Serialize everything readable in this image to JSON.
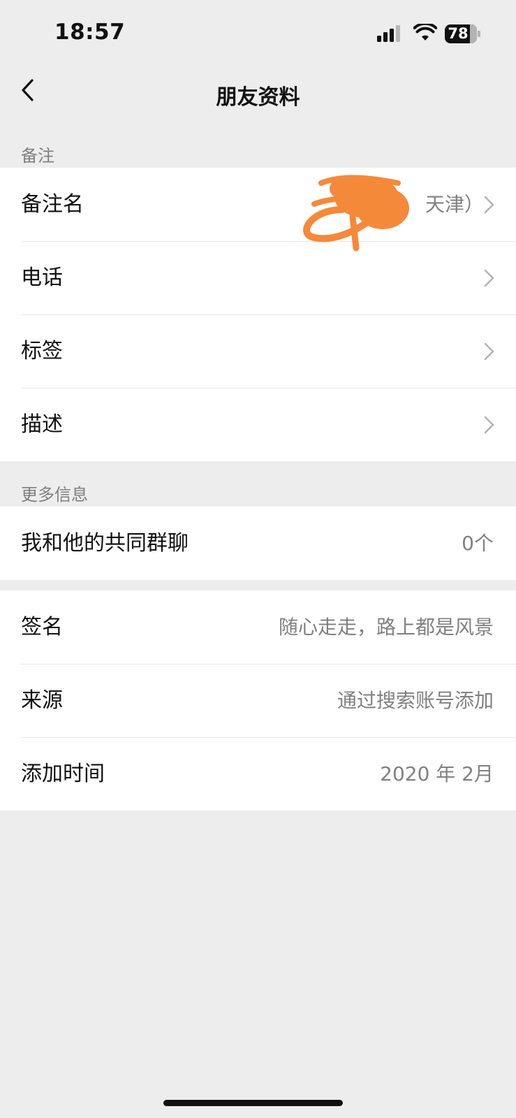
{
  "status_bar": {
    "time": "18:57",
    "battery_level": "78"
  },
  "nav": {
    "title": "朋友资料"
  },
  "section_remark": {
    "header": "备注",
    "rows": [
      {
        "label": "备注名",
        "value": "天津）"
      },
      {
        "label": "电话",
        "value": ""
      },
      {
        "label": "标签",
        "value": ""
      },
      {
        "label": "描述",
        "value": ""
      }
    ]
  },
  "section_more": {
    "header": "更多信息",
    "common_groups": {
      "label": "我和他的共同群聊",
      "value": "0个"
    },
    "rows": [
      {
        "label": "签名",
        "value": "随心走走，路上都是风景"
      },
      {
        "label": "来源",
        "value": "通过搜索账号添加"
      },
      {
        "label": "添加时间",
        "value": "2020 年 2月"
      }
    ]
  },
  "colors": {
    "background": "#ededed",
    "scribble": "#f5893a",
    "accent_text": "#111111"
  },
  "icons": [
    "back-chevron-icon",
    "chevron-right-icon",
    "signal-icon",
    "wifi-icon",
    "battery-icon"
  ]
}
